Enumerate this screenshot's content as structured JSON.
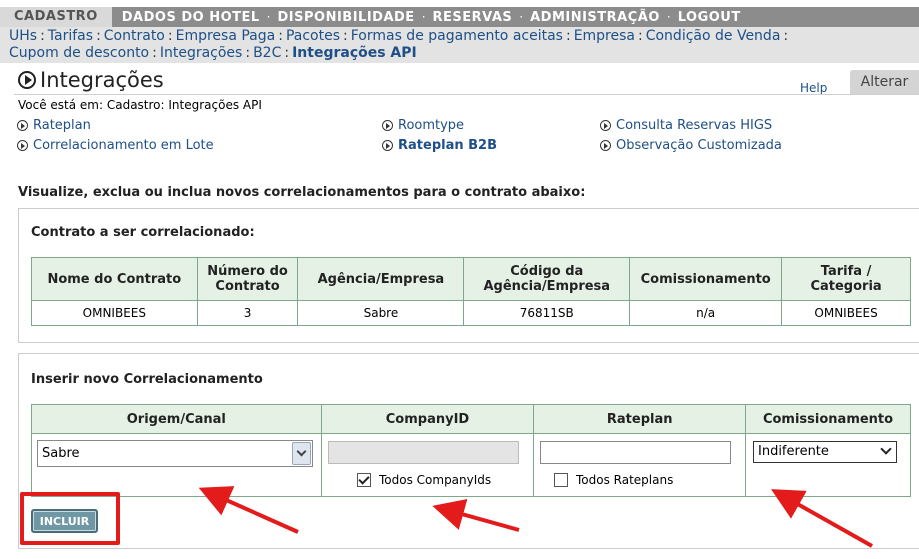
{
  "topnav": {
    "active": "CADASTRO",
    "items": [
      "DADOS DO HOTEL",
      "DISPONIBILIDADE",
      "RESERVAS",
      "ADMINISTRAÇÃO",
      "LOGOUT"
    ],
    "separator": "·"
  },
  "subnav": {
    "items": [
      "UHs",
      "Tarifas",
      "Contrato",
      "Empresa Paga",
      "Pacotes",
      "Formas de pagamento aceitas",
      "Empresa",
      "Condição de Venda",
      "Cupom de desconto",
      "Integrações",
      "B2C"
    ],
    "current": "Integrações API",
    "separator": ":"
  },
  "page": {
    "title": "Integrações",
    "help": "Help",
    "alterar": "Alterar",
    "breadcrumb": "Você está em: Cadastro: Integrações API"
  },
  "links": {
    "rateplan": "Rateplan",
    "roomtype": "Roomtype",
    "consulta": "Consulta Reservas HIGS",
    "correlacionamento": "Correlacionamento em Lote",
    "rateplan_b2b": "Rateplan B2B",
    "observacao": "Observação Customizada"
  },
  "intro": "Visualize, exclua ou inclua novos correlacionamentos para o contrato abaixo:",
  "contract": {
    "title": "Contrato a ser correlacionado:",
    "headers": [
      "Nome do Contrato",
      "Número do Contrato",
      "Agência/Empresa",
      "Código da Agência/Empresa",
      "Comissionamento",
      "Tarifa / Categoria"
    ],
    "row": [
      "OMNIBEES",
      "3",
      "Sabre",
      "76811SB",
      "n/a",
      "OMNIBEES"
    ]
  },
  "insert": {
    "title": "Inserir novo Correlacionamento",
    "headers": [
      "Origem/Canal",
      "CompanyID",
      "Rateplan",
      "Comissionamento"
    ],
    "origem_value": "Sabre",
    "company_checkbox": "Todos CompanyIds",
    "company_checked": true,
    "rateplan_checkbox": "Todos Rateplans",
    "rateplan_checked": false,
    "comissionamento_value": "Indiferente",
    "button": "INCLUIR"
  },
  "colors": {
    "annotation": "#e31b1b",
    "table_header": "#e6f1e6",
    "button": "#6f97a4",
    "topnav": "#8c8c8c"
  }
}
